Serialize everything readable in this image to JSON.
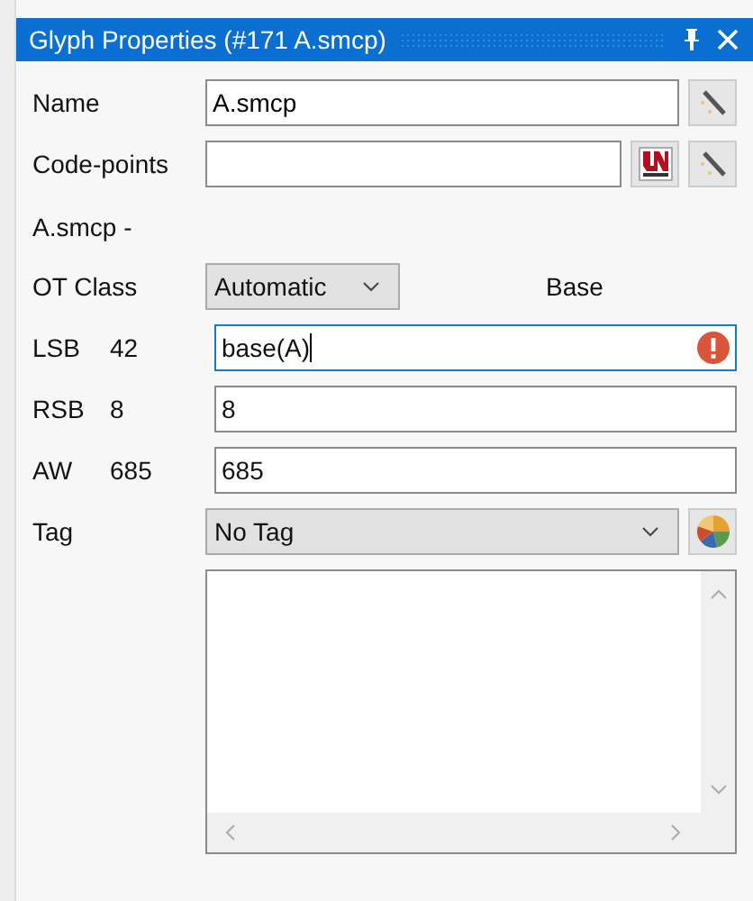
{
  "window": {
    "title": "Glyph Properties (#171 A.smcp)"
  },
  "name_field": {
    "label": "Name",
    "value": "A.smcp"
  },
  "codepoints_field": {
    "label": "Code-points"
  },
  "glyph_summary": "A.smcp -",
  "ot_class": {
    "label": "OT Class",
    "value": "Automatic",
    "result": "Base"
  },
  "metrics": [
    {
      "label": "LSB",
      "reading": "42",
      "value": "base(A)",
      "focused": true,
      "error": true
    },
    {
      "label": "RSB",
      "reading": "8",
      "value": "8",
      "focused": false,
      "error": false
    },
    {
      "label": "AW",
      "reading": "685",
      "value": "685",
      "focused": false,
      "error": false
    }
  ],
  "tag": {
    "label": "Tag",
    "value": "No Tag"
  }
}
